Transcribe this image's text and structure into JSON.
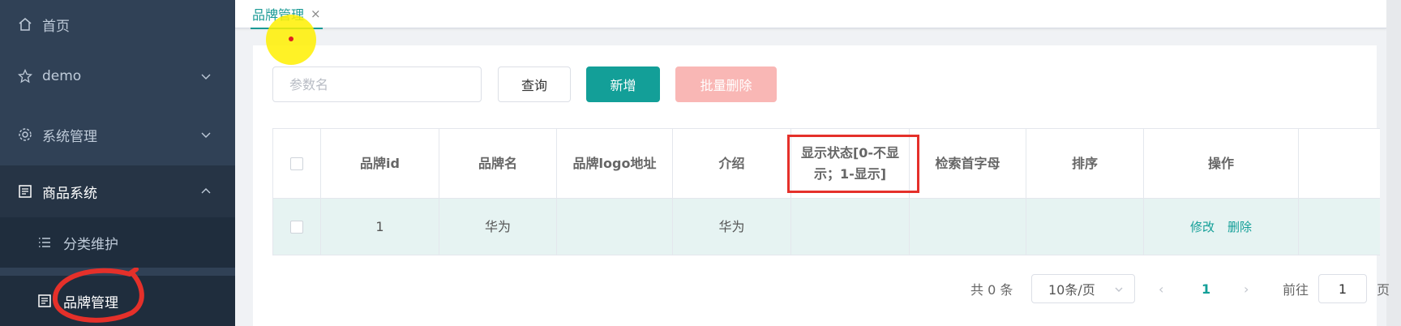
{
  "sidebar": {
    "items": [
      {
        "label": "首页",
        "icon": "home-icon"
      },
      {
        "label": "demo",
        "icon": "star-icon"
      },
      {
        "label": "系统管理",
        "icon": "gear-icon"
      },
      {
        "label": "商品系统",
        "icon": "product-icon"
      }
    ],
    "sub_items": [
      {
        "label": "分类维护",
        "icon": "list-icon"
      },
      {
        "label": "品牌管理",
        "icon": "brand-icon"
      }
    ]
  },
  "tabs": [
    {
      "label": "品牌管理",
      "close": "×"
    }
  ],
  "toolbar": {
    "search_placeholder": "参数名",
    "query_label": "查询",
    "add_label": "新增",
    "batch_delete_label": "批量删除"
  },
  "table": {
    "headers": [
      "品牌id",
      "品牌名",
      "品牌logo地址",
      "介绍",
      "显示状态[0-不显\n示；1-显示]",
      "检索首字母",
      "排序",
      "操作"
    ],
    "rows": [
      {
        "brand_id": "1",
        "name": "华为",
        "logo": "",
        "description": "华为",
        "show_status": "",
        "first_letter": "",
        "sort": "",
        "edit": "修改",
        "delete": "删除"
      }
    ]
  },
  "pagination": {
    "total_text": "共 0 条",
    "page_size": "10条/页",
    "prev": "‹",
    "current_page": "1",
    "next": "›",
    "goto_label": "前往",
    "goto_value": "1",
    "page_suffix": "页"
  },
  "colors": {
    "sidebar_bg": "#304156",
    "primary": "#139f98",
    "danger_light": "#f9b7b5",
    "annotation_red": "#e5302a"
  }
}
